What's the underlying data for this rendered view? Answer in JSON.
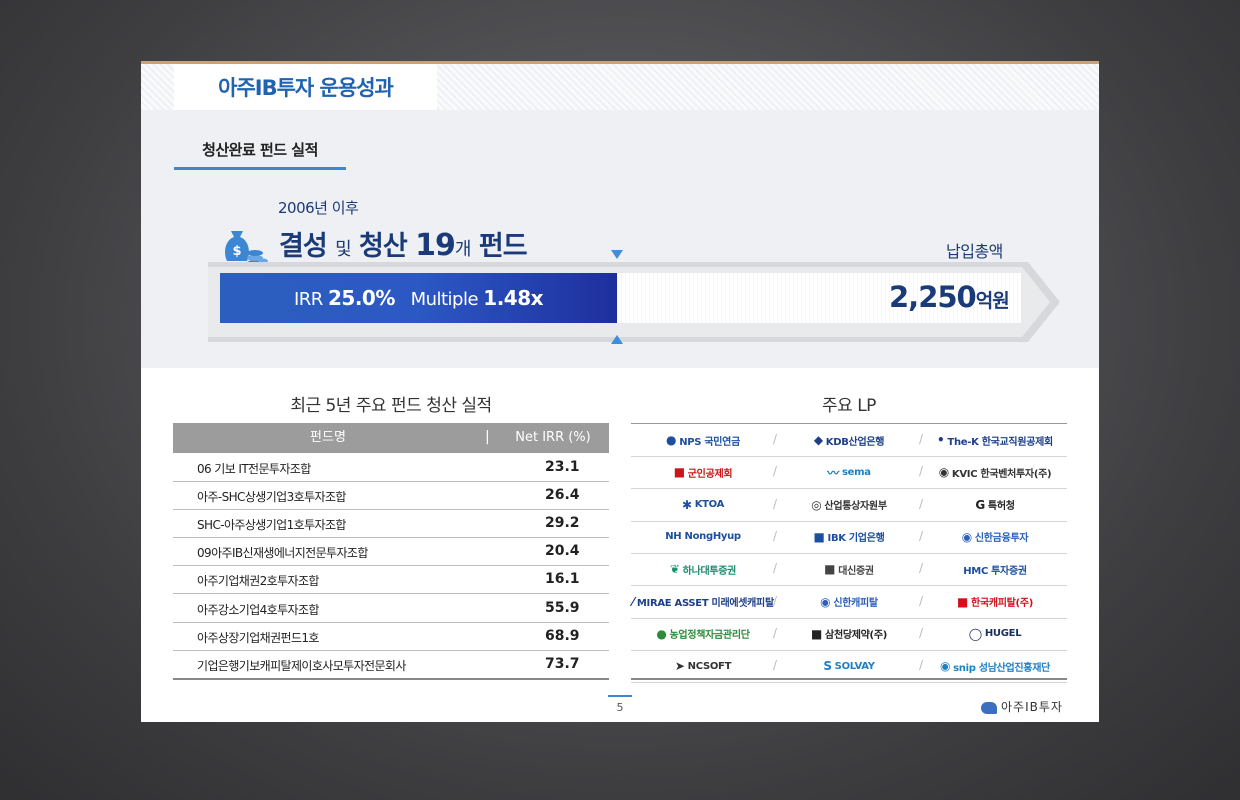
{
  "header": {
    "title": "아주IB투자 운용성과"
  },
  "section": {
    "title": "청산완료 펀드 실적"
  },
  "summary": {
    "since": "2006년 이후",
    "headline_a": "결성 ",
    "headline_b": "및",
    "headline_c": " 청산 ",
    "headline_num": "19",
    "headline_d": "개",
    "headline_e": " 펀드",
    "irr_label": "IRR ",
    "irr_value": "25.0%",
    "multiple_label": "Multiple ",
    "multiple_value": "1.48x",
    "paid_label": "납입총액",
    "amount": "2,250",
    "amount_unit": "억원"
  },
  "recent": {
    "title": "최근 5년 주요 펀드 청산 실적",
    "col_name": "펀드명",
    "col_irr": "Net IRR (%)",
    "rows": [
      {
        "name": "06 기보 IT전문투자조합",
        "irr": "23.1"
      },
      {
        "name": "아주-SHC상생기업3호투자조합",
        "irr": "26.4"
      },
      {
        "name": "SHC-아주상생기업1호투자조합",
        "irr": "29.2"
      },
      {
        "name": "09아주IB신재생에너지전문투자조합",
        "irr": "20.4"
      },
      {
        "name": "아주기업채권2호투자조합",
        "irr": "16.1"
      },
      {
        "name": "아주강소기업4호투자조합",
        "irr": "55.9"
      },
      {
        "name": "아주상장기업채권펀드1호",
        "irr": "68.9"
      },
      {
        "name": "기업은행기보캐피탈제이호사모투자전문회사",
        "irr": "73.7"
      }
    ]
  },
  "lp": {
    "title": "주요 LP",
    "rows": [
      [
        {
          "name": "NPS 국민연금",
          "color": "#1d4fa0"
        },
        {
          "name": "KDB산업은행",
          "color": "#1d3f8a"
        },
        {
          "name": "The-K 한국교직원공제회",
          "color": "#1d3f8a"
        }
      ],
      [
        {
          "name": "군인공제회",
          "color": "#d0121b"
        },
        {
          "name": "sema",
          "color": "#1f7fc4"
        },
        {
          "name": "KVIC 한국벤처투자(주)",
          "color": "#333333"
        }
      ],
      [
        {
          "name": "KTOA",
          "color": "#1d4fa0"
        },
        {
          "name": "산업통상자원부",
          "color": "#333333"
        },
        {
          "name": "특허청",
          "color": "#222222"
        }
      ],
      [
        {
          "name": "NH NongHyup",
          "color": "#1d4fa0"
        },
        {
          "name": "IBK 기업은행",
          "color": "#1d4fa0"
        },
        {
          "name": "신한금융투자",
          "color": "#2b5fbd"
        }
      ],
      [
        {
          "name": "하나대투증권",
          "color": "#1a8f6e"
        },
        {
          "name": "대신증권",
          "color": "#444444"
        },
        {
          "name": "HMC 투자증권",
          "color": "#1d4fa0"
        }
      ],
      [
        {
          "name": "MIRAE ASSET 미래에셋캐피탈",
          "color": "#1d3f8a"
        },
        {
          "name": "신한캐피탈",
          "color": "#2b5fbd"
        },
        {
          "name": "한국캐피탈(주)",
          "color": "#d0121b"
        }
      ],
      [
        {
          "name": "농업정책자금관리단",
          "color": "#2e8b3a"
        },
        {
          "name": "삼천당제약(주)",
          "color": "#222222"
        },
        {
          "name": "HUGEL",
          "color": "#1a2f5c"
        }
      ],
      [
        {
          "name": "NCSOFT",
          "color": "#333333"
        },
        {
          "name": "SOLVAY",
          "color": "#1f7fc4"
        },
        {
          "name": "snip 성남산업진흥재단",
          "color": "#1f7fc4"
        }
      ]
    ],
    "icons": [
      [
        "circle-icon",
        "diamond-icon",
        "dot-icon"
      ],
      [
        "square-icon",
        "wave-icon",
        "oval-icon"
      ],
      [
        "star-icon",
        "emblem-icon",
        "g-mark-icon"
      ],
      [
        "arrow-icon",
        "square-icon",
        "circle-icon"
      ],
      [
        "leaf-icon",
        "square-icon",
        "text-icon"
      ],
      [
        "swoosh-icon",
        "circle-icon",
        "square-icon"
      ],
      [
        "circle-icon",
        "square-icon",
        "ring-icon"
      ],
      [
        "check-icon",
        "s-mark-icon",
        "oval-icon"
      ]
    ],
    "glyphs": [
      [
        "●",
        "◆",
        "•"
      ],
      [
        "■",
        "〰",
        "◉"
      ],
      [
        "✱",
        "◎",
        "G"
      ],
      [
        "",
        "■",
        "◉"
      ],
      [
        "❦",
        "■",
        ""
      ],
      [
        "⁄",
        "◉",
        "■"
      ],
      [
        "●",
        "■",
        "◯"
      ],
      [
        "➤",
        "S",
        "◉"
      ]
    ]
  },
  "footer": {
    "page": "5",
    "brand": "아주IB투자"
  }
}
